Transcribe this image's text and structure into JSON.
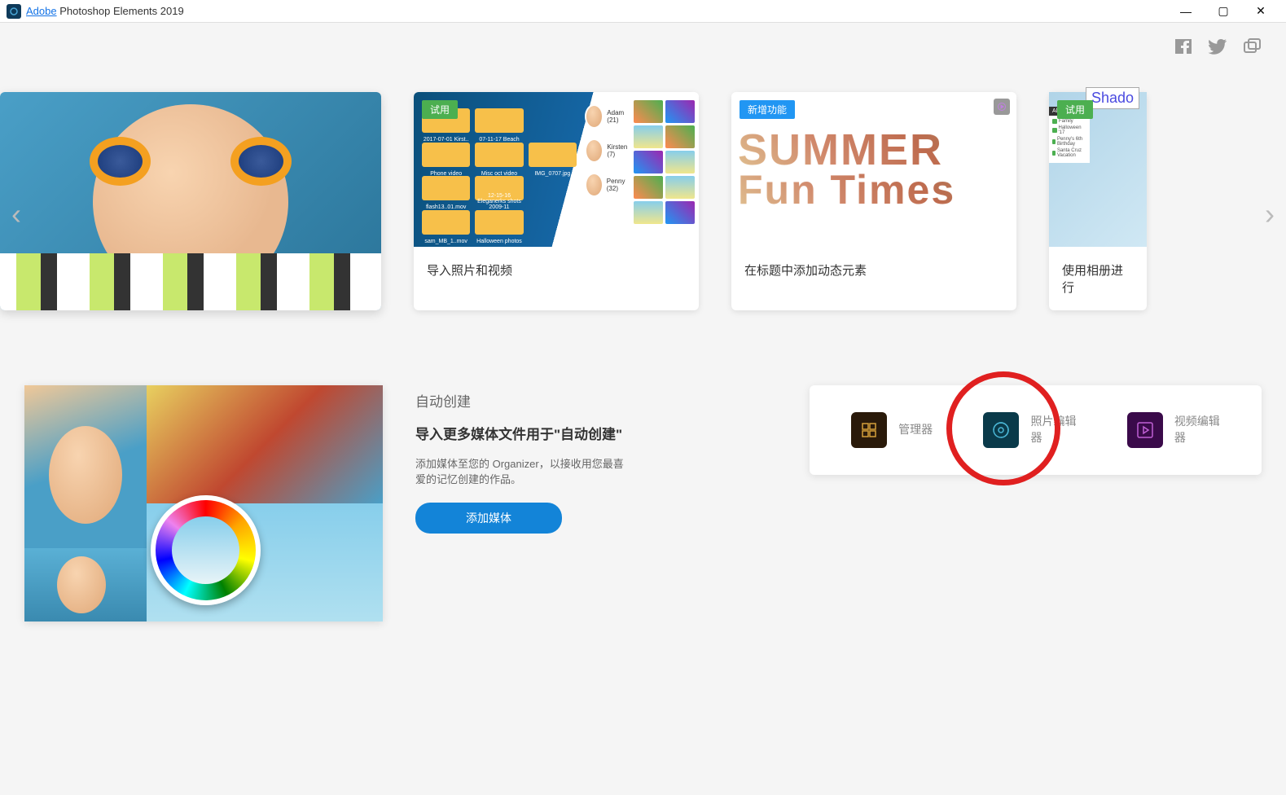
{
  "titlebar": {
    "app_prefix": "Adobe",
    "app_suffix": " Photoshop Elements 2019"
  },
  "social": {
    "facebook": "facebook-icon",
    "twitter": "twitter-icon",
    "share": "share-icon"
  },
  "carousel": {
    "cards": [
      {
        "badge": "试用",
        "caption": "导入照片和视频",
        "badge_type": "trial",
        "folders": [
          "2017-07-01 Kirst..",
          "07-11-17 Beach",
          "Phone video",
          "Misc oct video",
          "IMG_0707.jpg",
          "flash13..01.mov",
          "12-15-16 Eleganerks shots 2009-11",
          "sam_MB_1..mov",
          "Halloween photos"
        ],
        "people": [
          {
            "name": "Adam (21)"
          },
          {
            "name": "Kirsten (7)"
          },
          {
            "name": "Penny (32)"
          }
        ]
      },
      {
        "badge": "新增功能",
        "caption": "在标题中添加动态元素",
        "badge_type": "new",
        "summer_line1": "SUMMER",
        "summer_line2": "Fun Times"
      },
      {
        "badge": "试用",
        "caption": "使用相册进行",
        "badge_type": "trial",
        "panel_title": "Albums",
        "albums": [
          "Family",
          "Halloween '17",
          "Penny's 6th Birthday",
          "Santa Cruz Vacation"
        ],
        "overlay": "Shado"
      }
    ]
  },
  "auto_create": {
    "title": "自动创建",
    "heading": "导入更多媒体文件用于\"自动创建\"",
    "description": "添加媒体至您的 Organizer，以接收用您最喜爱的记忆创建的作品。",
    "button": "添加媒体"
  },
  "launcher": {
    "organizer": "管理器",
    "photo_editor": "照片编辑器",
    "video_editor": "视频编辑器"
  }
}
